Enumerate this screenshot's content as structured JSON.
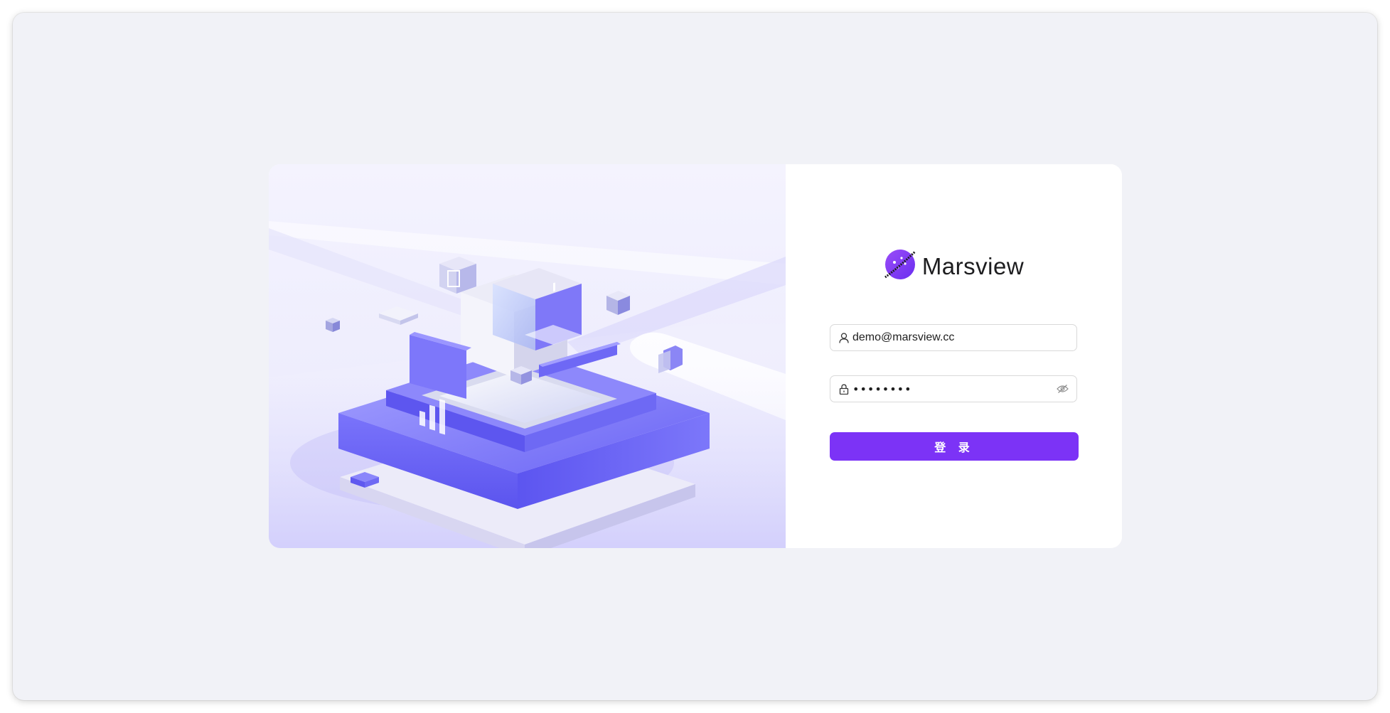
{
  "brand": {
    "name": "Marsview",
    "logo_icon": "planet-icon",
    "accent_color": "#7c33f6"
  },
  "login_form": {
    "username": {
      "value": "demo@marsview.cc",
      "icon": "user-icon"
    },
    "password": {
      "masked_value": "••••••••",
      "icon": "lock-icon",
      "toggle_icon": "eye-invisible-icon"
    },
    "submit_label": "登 录"
  },
  "illustration": {
    "icon": "isometric-data-platform-illustration"
  }
}
